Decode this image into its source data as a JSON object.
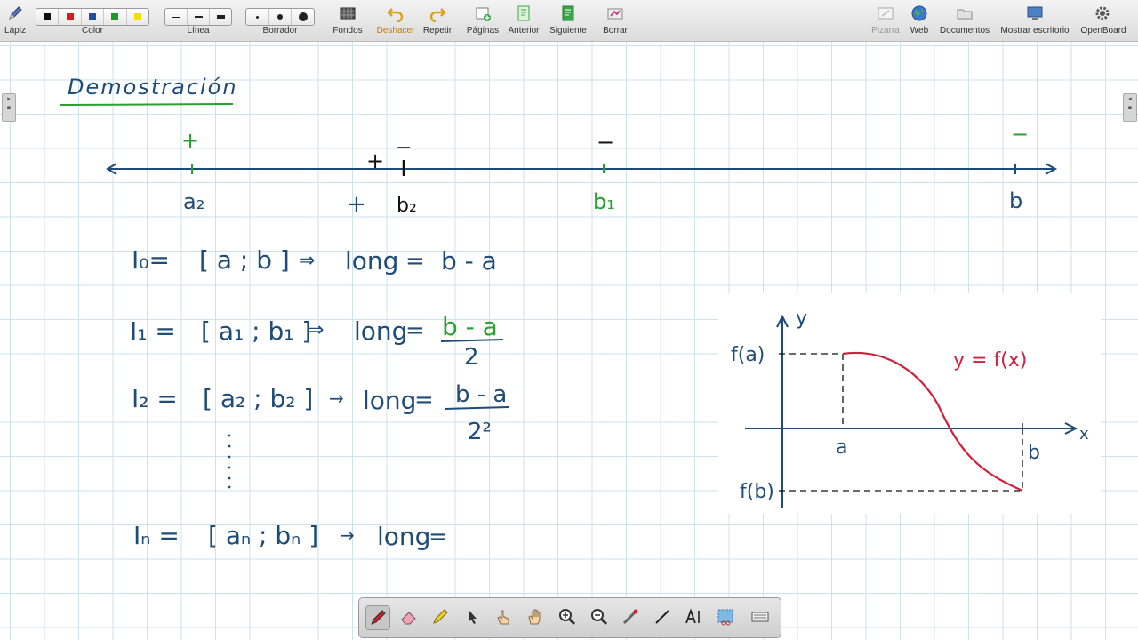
{
  "toolbar": {
    "pencil": "Lápiz",
    "color": "Color",
    "line": "Línea",
    "eraser": "Borrador",
    "backgrounds": "Fondos",
    "undo": "Deshacer",
    "redo": "Repetir",
    "pages": "Páginas",
    "previous": "Anterior",
    "next": "Siguiente",
    "clear": "Borrar",
    "board": "Pizarra",
    "web": "Web",
    "documents": "Documentos",
    "show_desktop": "Mostrar escritorio",
    "openboard": "OpenBoard"
  },
  "palette": [
    "#111111",
    "#d81b1b",
    "#1e4fa0",
    "#1a9a2a",
    "#f4e000"
  ],
  "accent": {
    "ink_blue": "#1f4b78",
    "ink_green": "#27a12f",
    "ink_red": "#d21f3c"
  },
  "board": {
    "title": "Demostración",
    "number_line": {
      "labels": [
        "a₂",
        "b₂",
        "b₁",
        "b"
      ],
      "signs": [
        "+",
        "+",
        "−",
        "−",
        "−",
        "+"
      ]
    },
    "rows": [
      {
        "interval": "I₀=",
        "bracket": "[ a ; b ]",
        "arrow": "⇒",
        "long": "long",
        "eq": "=",
        "value": "b - a"
      },
      {
        "interval": "I₁ =",
        "bracket": "[ a₁ ; b₁ ]",
        "arrow": "⇒",
        "long": "long",
        "eq": "=",
        "num": "b - a",
        "den": "2"
      },
      {
        "interval": "I₂ =",
        "bracket": "[ a₂ ; b₂ ]",
        "arrow": "→",
        "long": "long",
        "eq": "=",
        "num": "b - a",
        "den": "2²"
      },
      {
        "interval": "Iₙ =",
        "bracket": "[ aₙ ; bₙ ]",
        "arrow": "→",
        "long": "long",
        "eq": "="
      }
    ],
    "graph": {
      "y_axis": "y",
      "x_axis": "x",
      "fa": "f(a)",
      "fb": "f(b)",
      "a": "a",
      "b": "b",
      "curve_label": "y = f(x)"
    }
  },
  "bottom_tools": [
    "pen-icon",
    "eraser-icon",
    "highlighter-icon",
    "pointer-icon",
    "hand-tap-icon",
    "hand-pan-icon",
    "zoom-in-icon",
    "zoom-out-icon",
    "laser-icon",
    "line-icon",
    "text-icon",
    "capture-icon",
    "keyboard-icon"
  ]
}
